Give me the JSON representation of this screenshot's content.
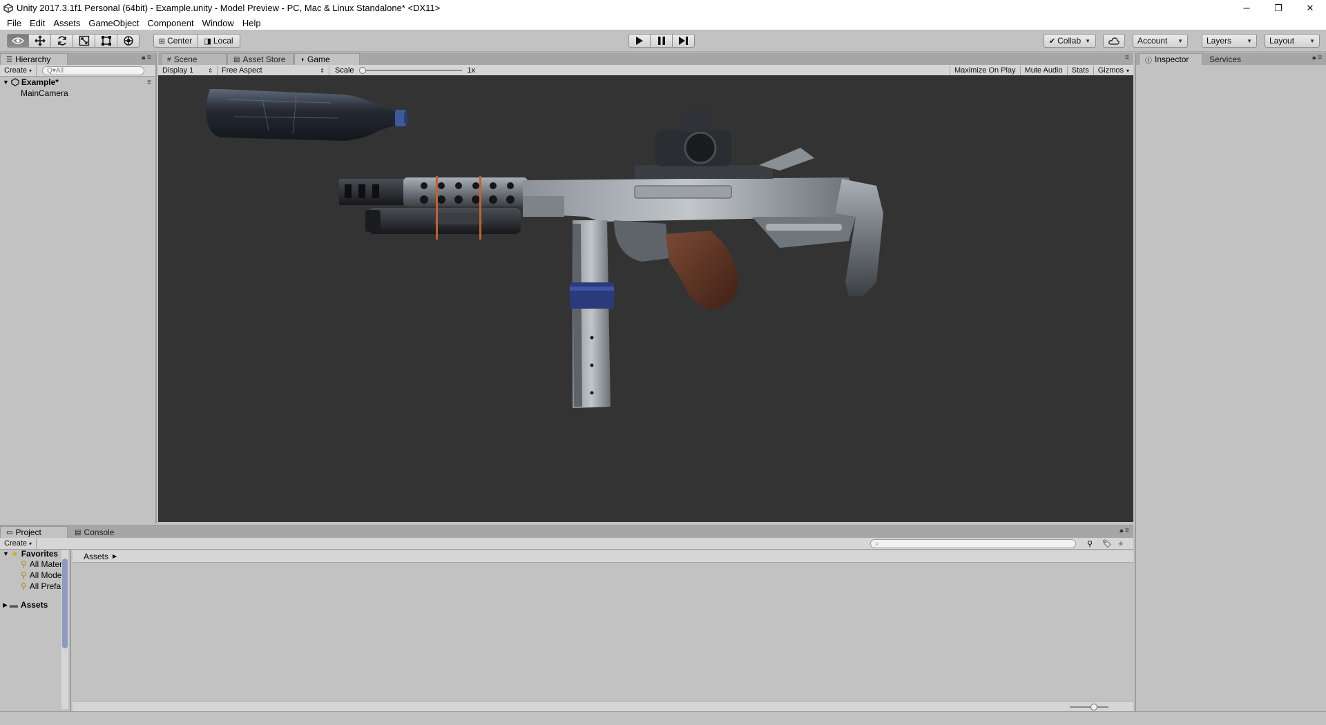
{
  "window": {
    "title": "Unity 2017.3.1f1 Personal (64bit) - Example.unity - Model Preview - PC, Mac & Linux Standalone* <DX11>",
    "minimize": "─",
    "restore": "❐",
    "close": "✕"
  },
  "menu": [
    "File",
    "Edit",
    "Assets",
    "GameObject",
    "Component",
    "Window",
    "Help"
  ],
  "toolbar": {
    "pivot_center": "Center",
    "pivot_local": "Local",
    "collab": "Collab",
    "account": "Account",
    "layers": "Layers",
    "layout": "Layout"
  },
  "hierarchy": {
    "tab": "Hierarchy",
    "create": "Create",
    "search_placeholder": "Q▾All",
    "scene": "Example*",
    "items": [
      "MainCamera"
    ]
  },
  "center_tabs": [
    "Scene",
    "Asset Store",
    "Game"
  ],
  "game_bar": {
    "display": "Display 1",
    "aspect": "Free Aspect",
    "scale_label": "Scale",
    "scale_value": "1x",
    "maximize": "Maximize On Play",
    "mute": "Mute Audio",
    "stats": "Stats",
    "gizmos": "Gizmos"
  },
  "right_tabs": [
    "Inspector",
    "Services"
  ],
  "project": {
    "tabs": [
      "Project",
      "Console"
    ],
    "create": "Create",
    "favorites_label": "Favorites",
    "favorites": [
      "All Materi",
      "All Model",
      "All Prefab"
    ],
    "assets_label": "Assets",
    "breadcrumb": "Assets"
  },
  "colors": {
    "editor_bg": "#c2c2c2",
    "game_bg": "#333333",
    "tab_bg": "#a6a6a6"
  }
}
